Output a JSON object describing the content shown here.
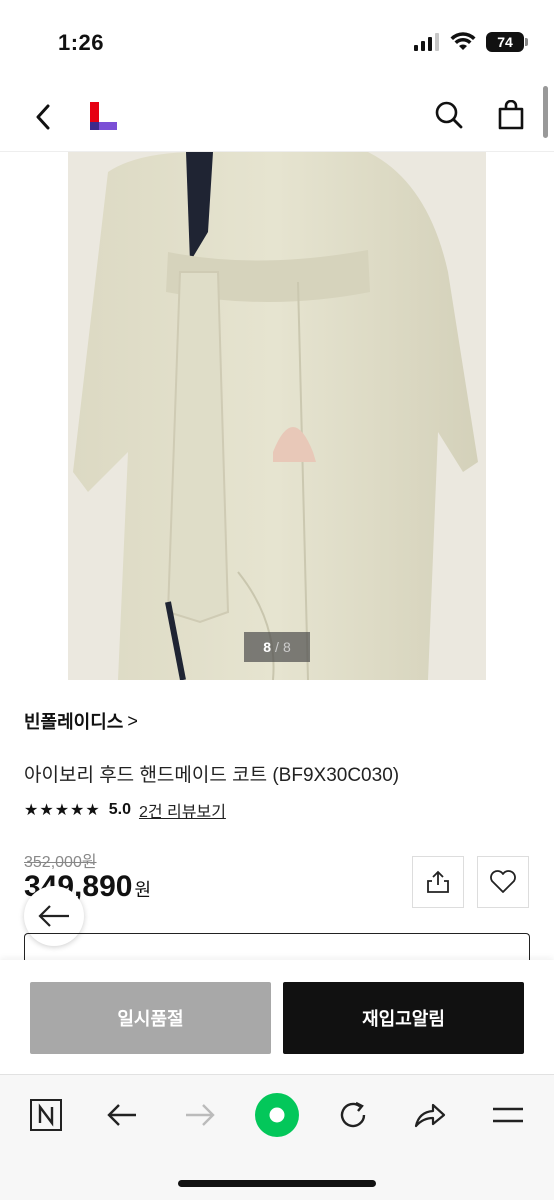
{
  "status": {
    "time": "1:26",
    "battery": "74"
  },
  "header": {
    "back_icon": "chevron-left-icon",
    "logo_icon": "brand-logo-icon",
    "search_icon": "search-icon",
    "cart_icon": "shopping-bag-icon"
  },
  "gallery": {
    "current": "8",
    "separator": "/",
    "total": "8"
  },
  "product": {
    "brand": "빈폴레이디스",
    "brand_chevron": ">",
    "title": "아이보리 후드 핸드메이드 코트 (BF9X30C030)",
    "stars": "★★★★★",
    "rating": "5.0",
    "review_link": "2건 리뷰보기",
    "original_price": "352,000원",
    "sale_price": "349,890",
    "currency": "원"
  },
  "actions": {
    "soldout_label": "일시품절",
    "restock_label": "재입고알림"
  },
  "colors": {
    "logo_red": "#e60012",
    "logo_purple": "#7b4fd6",
    "toggle_green": "#03c75a",
    "soldout_gray": "#a8a8a8"
  }
}
